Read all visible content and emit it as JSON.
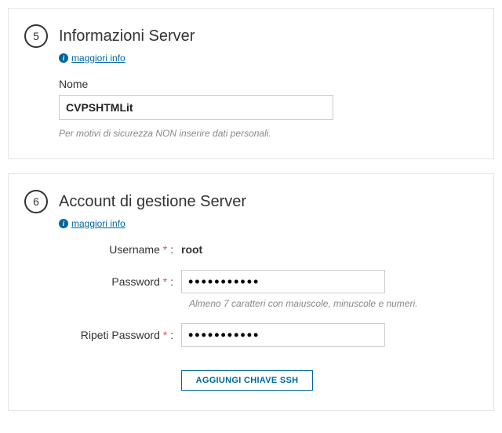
{
  "section5": {
    "step": "5",
    "title": "Informazioni Server",
    "moreInfo": "maggiori info",
    "nameLabel": "Nome",
    "nameValue": "CVPSHTMLit",
    "hint": "Per motivi di sicurezza NON inserire dati personali."
  },
  "section6": {
    "step": "6",
    "title": "Account di gestione Server",
    "moreInfo": "maggiori info",
    "usernameLabel": "Username",
    "usernameValue": "root",
    "passwordLabel": "Password",
    "passwordValue": "•••••••••••",
    "passwordHint": "Almeno 7 caratteri con maiuscole, minuscole e numeri.",
    "repeatPasswordLabel": "Ripeti Password",
    "repeatPasswordValue": "•••••••••••",
    "addSshLabel": "AGGIUNGI CHIAVE SSH",
    "colon": " :",
    "reqColon": " * :"
  }
}
